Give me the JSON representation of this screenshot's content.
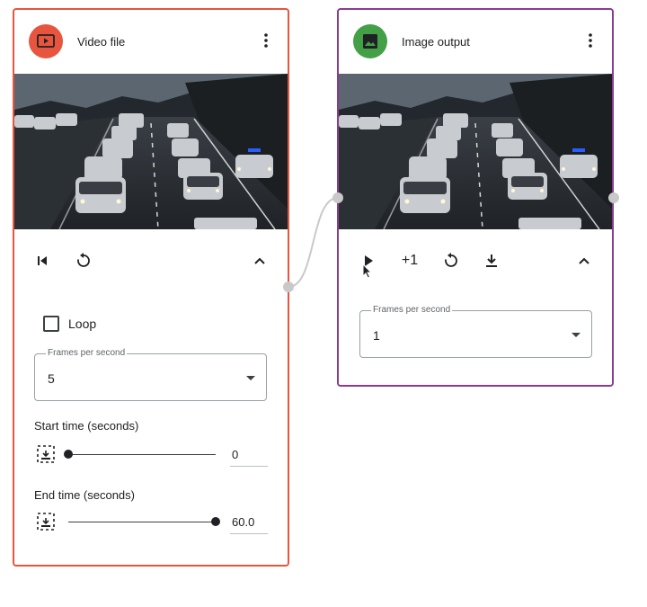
{
  "video_node": {
    "title": "Video file",
    "icon_color": "#e8553e",
    "border_color": "#e8553e",
    "header_icon": "video-file-icon",
    "controls": [
      "skip-to-start-icon",
      "restart-icon",
      "collapse-icon"
    ],
    "loop_label": "Loop",
    "loop_checked": false,
    "fps": {
      "label": "Frames per second",
      "value": "5"
    },
    "start": {
      "label": "Start time (seconds)",
      "value": "0",
      "slider_fraction": 0.0
    },
    "end": {
      "label": "End time (seconds)",
      "value": "60.0",
      "slider_fraction": 1.0
    }
  },
  "image_node": {
    "title": "Image output",
    "icon_color": "#43a047",
    "border_color": "#8a3c93",
    "header_icon": "image-icon",
    "controls": [
      "play-icon",
      "restart-icon",
      "download-icon",
      "collapse-icon"
    ],
    "step_label": "+1",
    "fps": {
      "label": "Frames per second",
      "value": "1"
    }
  },
  "colors": {
    "wire": "#c9c9c9",
    "port": "#c9c9c9"
  }
}
